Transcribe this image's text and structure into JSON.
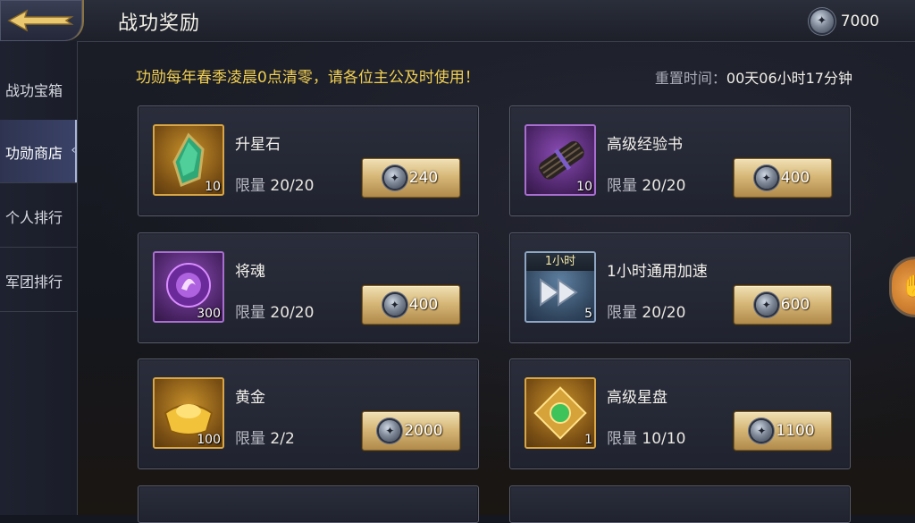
{
  "header": {
    "title": "战功奖励",
    "currency_value": "7000",
    "currency_icon": "merit-medal-icon"
  },
  "sidebar": {
    "items": [
      {
        "label": "战功宝箱",
        "active": false
      },
      {
        "label": "功勋商店",
        "active": true
      },
      {
        "label": "个人排行",
        "active": false
      },
      {
        "label": "军团排行",
        "active": false
      }
    ]
  },
  "notice": "功勋每年春季凌晨0点清零，请各位主公及时使用！",
  "reset": {
    "label": "重置时间：",
    "time": "00天06小时17分钟"
  },
  "items": [
    {
      "name": "升星石",
      "qty": "10",
      "limit_label": "限量",
      "limit": "20/20",
      "price": "240",
      "icon": "green-gem-icon",
      "frame": "gold"
    },
    {
      "name": "高级经验书",
      "qty": "10",
      "limit_label": "限量",
      "limit": "20/20",
      "price": "400",
      "icon": "scroll-bundle-icon",
      "frame": "purple"
    },
    {
      "name": "将魂",
      "qty": "300",
      "limit_label": "限量",
      "limit": "20/20",
      "price": "400",
      "icon": "purple-soul-orb-icon",
      "frame": "purple"
    },
    {
      "name": "1小时通用加速",
      "qty": "5",
      "badge": "1小时",
      "limit_label": "限量",
      "limit": "20/20",
      "price": "600",
      "icon": "fast-forward-icon",
      "frame": "blue"
    },
    {
      "name": "黄金",
      "qty": "100",
      "limit_label": "限量",
      "limit": "2/2",
      "price": "2000",
      "icon": "gold-ingot-icon",
      "frame": "gold"
    },
    {
      "name": "高级星盘",
      "qty": "1",
      "limit_label": "限量",
      "limit": "10/10",
      "price": "1100",
      "icon": "star-plate-icon",
      "frame": "gold"
    }
  ]
}
